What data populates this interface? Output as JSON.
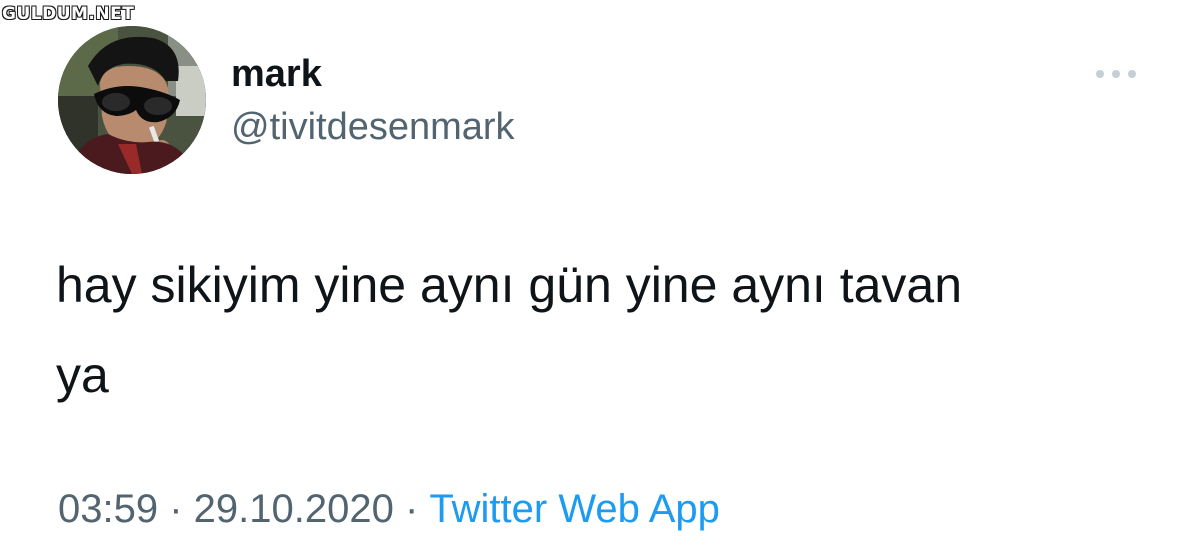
{
  "watermark": "GULDUM.NET",
  "author": {
    "display_name": "mark",
    "handle": "@tivitdesenmark"
  },
  "tweet": {
    "text_line_1": "hay sikiyim yine aynı gün yine aynı tavan",
    "text_line_2": "ya"
  },
  "meta": {
    "time": "03:59",
    "separator": " · ",
    "date": "29.10.2020",
    "source": "Twitter Web App"
  },
  "colors": {
    "text_primary": "#0f1419",
    "text_secondary": "#536471",
    "link": "#1d9bf0"
  },
  "icons": {
    "more": "more-horizontal-icon"
  }
}
